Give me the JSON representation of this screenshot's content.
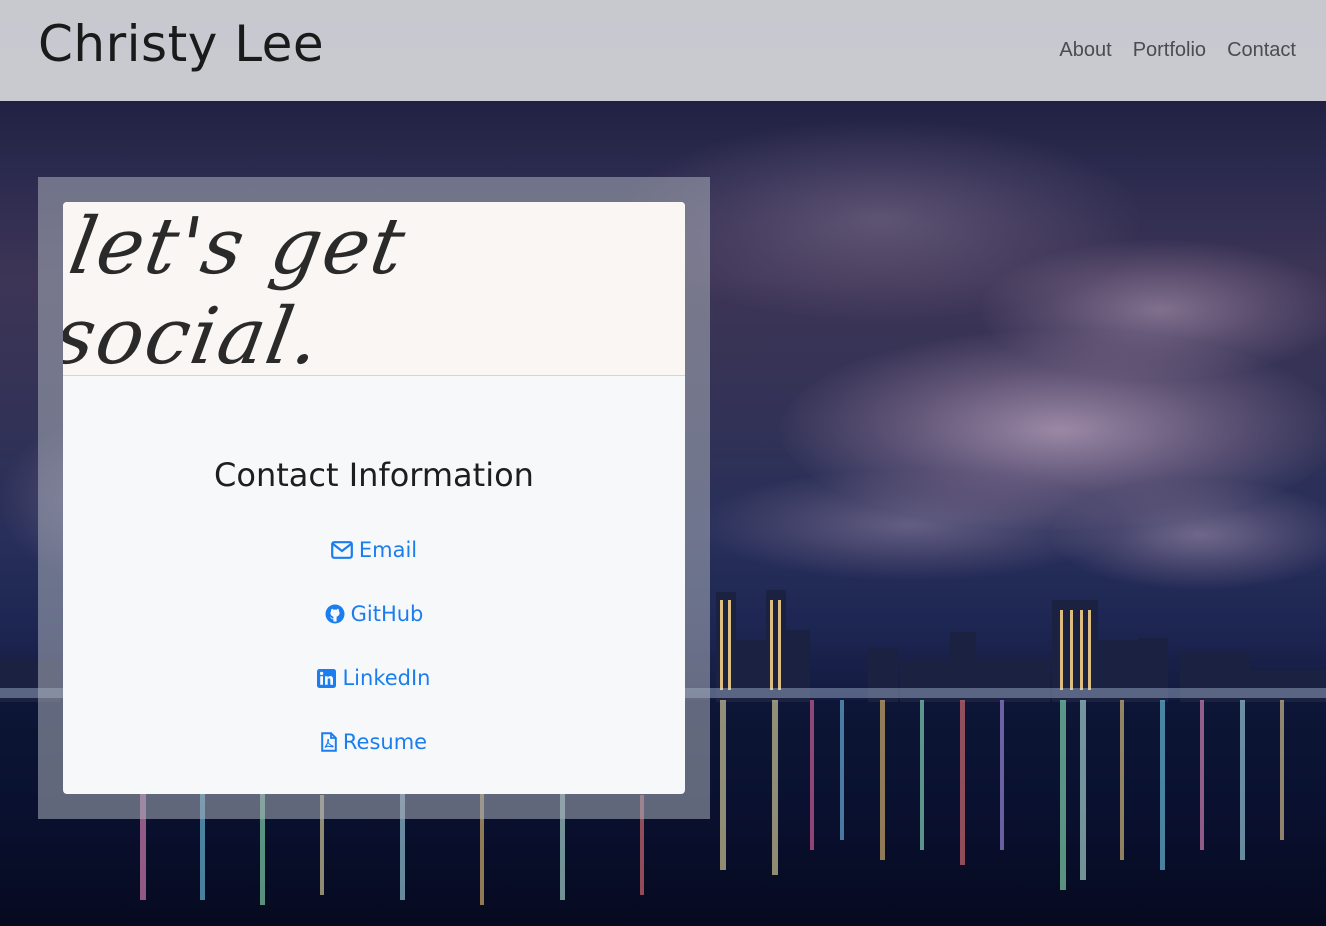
{
  "header": {
    "brand": "Christy Lee",
    "nav": [
      "About",
      "Portfolio",
      "Contact"
    ]
  },
  "card": {
    "image_text": "let's get social.",
    "title": "Contact Information",
    "links": [
      {
        "label": "Email",
        "icon": "envelope-icon"
      },
      {
        "label": "GitHub",
        "icon": "github-icon"
      },
      {
        "label": "LinkedIn",
        "icon": "linkedin-icon"
      },
      {
        "label": "Resume",
        "icon": "pdf-file-icon"
      }
    ]
  },
  "colors": {
    "link": "#1a7ef0",
    "navbar": "#d6d7dc",
    "card": "#f7f8fa"
  }
}
